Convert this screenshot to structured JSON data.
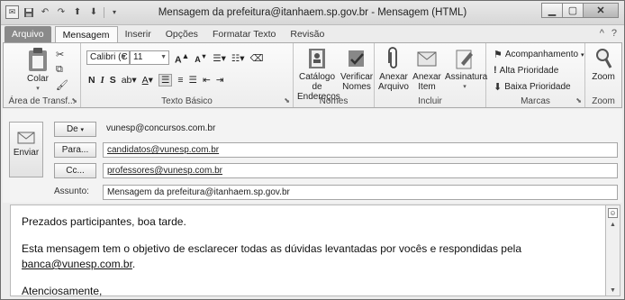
{
  "window": {
    "title": "Mensagem da prefeitura@itanhaem.sp.gov.br  -  Mensagem (HTML)",
    "quick_access": [
      "save-icon",
      "undo-icon",
      "redo-icon",
      "up-arrow-icon",
      "down-arrow-icon"
    ],
    "controls": {
      "minimize": "▁",
      "maximize": "▢",
      "close": "✕"
    }
  },
  "ribbon_tabs": [
    {
      "label": "Arquivo"
    },
    {
      "label": "Mensagem"
    },
    {
      "label": "Inserir"
    },
    {
      "label": "Opções"
    },
    {
      "label": "Formatar Texto"
    },
    {
      "label": "Revisão"
    }
  ],
  "tabs_right": {
    "help": "?",
    "collapse": "^"
  },
  "groups": {
    "clipboard": {
      "label": "Área de Transf...",
      "paste": "Colar"
    },
    "basic_text": {
      "label": "Texto Básico",
      "font_name": "Calibri (C",
      "font_size": "11",
      "grow": "A",
      "shrink": "A",
      "bold": "N",
      "italic": "I",
      "underline": "S"
    },
    "names": {
      "label": "Nomes",
      "address_book": "Catálogo de\nEndereços",
      "check_names": "Verificar\nNomes"
    },
    "include": {
      "label": "Incluir",
      "attach_file": "Anexar\nArquivo",
      "attach_item": "Anexar\nItem",
      "signature": "Assinatura"
    },
    "tags": {
      "label": "Marcas",
      "follow_up": "Acompanhamento",
      "high_priority": "Alta Prioridade",
      "low_priority": "Baixa Prioridade"
    },
    "zoom": {
      "label": "Zoom",
      "zoom": "Zoom"
    }
  },
  "header": {
    "send": "Enviar",
    "from_button": "De",
    "from_value": "vunesp@concursos.com.br",
    "to_button": "Para...",
    "to_value": "candidatos@vunesp.com.br",
    "cc_button": "Cc...",
    "cc_value": "professores@vunesp.com.br",
    "subject_label": "Assunto:",
    "subject_value": "Mensagem da prefeitura@itanhaem.sp.gov.br"
  },
  "message_body": {
    "greeting": "Prezados participantes, boa tarde.",
    "line2_before": "Esta mensagem tem o objetivo de esclarecer todas as dúvidas levantadas por vocês e respondidas pela ",
    "line2_email": "banca@vunesp.com.br",
    "line2_after": ".",
    "closing": "Atenciosamente,"
  }
}
